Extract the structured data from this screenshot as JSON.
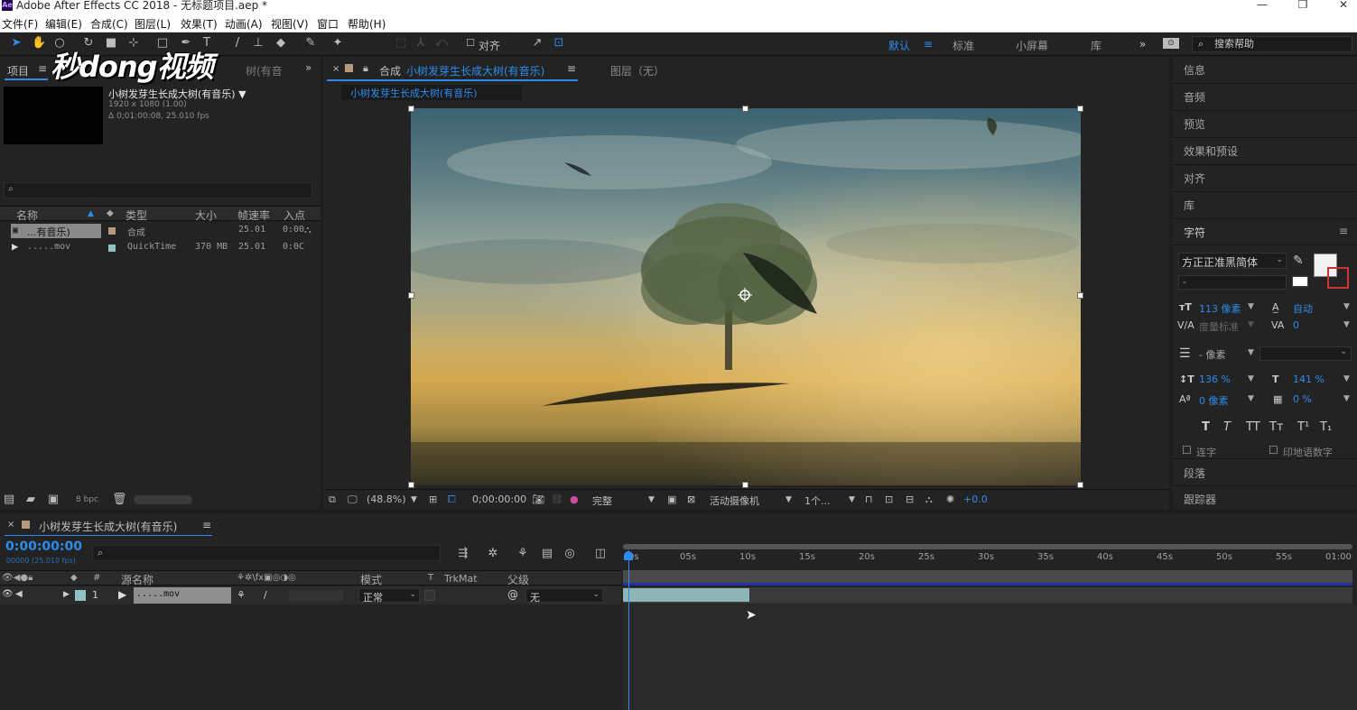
{
  "window": {
    "title": "Adobe After Effects CC 2018 - 无标题项目.aep *",
    "minimize": "—",
    "maximize": "❐",
    "close": "✕"
  },
  "menu": [
    "文件(F)",
    "编辑(E)",
    "合成(C)",
    "图层(L)",
    "效果(T)",
    "动画(A)",
    "视图(V)",
    "窗口",
    "帮助(H)"
  ],
  "toolbar": {
    "align_label": "对齐",
    "workspaces": [
      "默认",
      "标准",
      "小屏幕",
      "库"
    ],
    "active_workspace": "默认",
    "help_search_placeholder": "搜索帮助"
  },
  "watermark": "秒dong视频",
  "project": {
    "tab": "项目",
    "tab2": "树(有音",
    "comp_name": "小树发芽生长成大树(有音乐) ▼",
    "comp_res": "1920 x 1080 (1.00)",
    "comp_dur": "Δ 0;01:00:08, 25.010 fps",
    "columns": [
      "名称",
      "类型",
      "大小",
      "帧速率",
      "入点"
    ],
    "rows": [
      {
        "name": "...有音乐)",
        "type": "合成",
        "size": "",
        "fps": "25.01",
        "in": "0:00",
        "color": "#b79a7a"
      },
      {
        "name": ".....mov",
        "type": "QuickTime",
        "size": "370 MB",
        "fps": "25.01",
        "in": "0:0C",
        "color": "#8fc2c2"
      }
    ],
    "bpc": "8 bpc"
  },
  "composition": {
    "tab": "合成",
    "tab_name": "小树发芽生长成大树(有音乐)",
    "layer_tab": "图层（无）",
    "breadcrumb": "小树发芽生长成大树(有音乐)",
    "zoom": "(48.8%)",
    "timecode": "0;00:00:00",
    "quality": "完整",
    "camera": "活动摄像机",
    "views": "1个...",
    "exposure": "+0.0"
  },
  "right_panel": {
    "tabs": [
      "信息",
      "音频",
      "预览",
      "效果和预设",
      "对齐",
      "库"
    ],
    "character": {
      "title": "字符",
      "font": "方正正准黑简体",
      "style": "-",
      "size": "113 像素",
      "leading": "自动",
      "kerning": "度量标准",
      "tracking": "0",
      "stroke": "- 像素",
      "vscale": "136 %",
      "hscale": "141 %",
      "baseline": "0 像素",
      "tsume": "0 %",
      "styles": [
        "T",
        "T",
        "TT",
        "Tт",
        "T¹",
        "T₁"
      ],
      "ligature": "连字",
      "hindi": "印地语数字"
    },
    "paragraph": "段落",
    "tracker": "跟踪器"
  },
  "timeline": {
    "tab": "小树发芽生长成大树(有音乐)",
    "time": "0:00:00:00",
    "time_sub": "00000 (25.010 fps)",
    "columns": [
      "#",
      "源名称",
      "模式",
      "T",
      "TrkMat",
      "父级"
    ],
    "layer": {
      "index": "1",
      "name": ".....mov",
      "mode": "正常",
      "parent": "无"
    },
    "ruler": [
      "0s",
      "05s",
      "10s",
      "15s",
      "20s",
      "25s",
      "30s",
      "35s",
      "40s",
      "45s",
      "50s",
      "55s",
      "01:00"
    ]
  }
}
